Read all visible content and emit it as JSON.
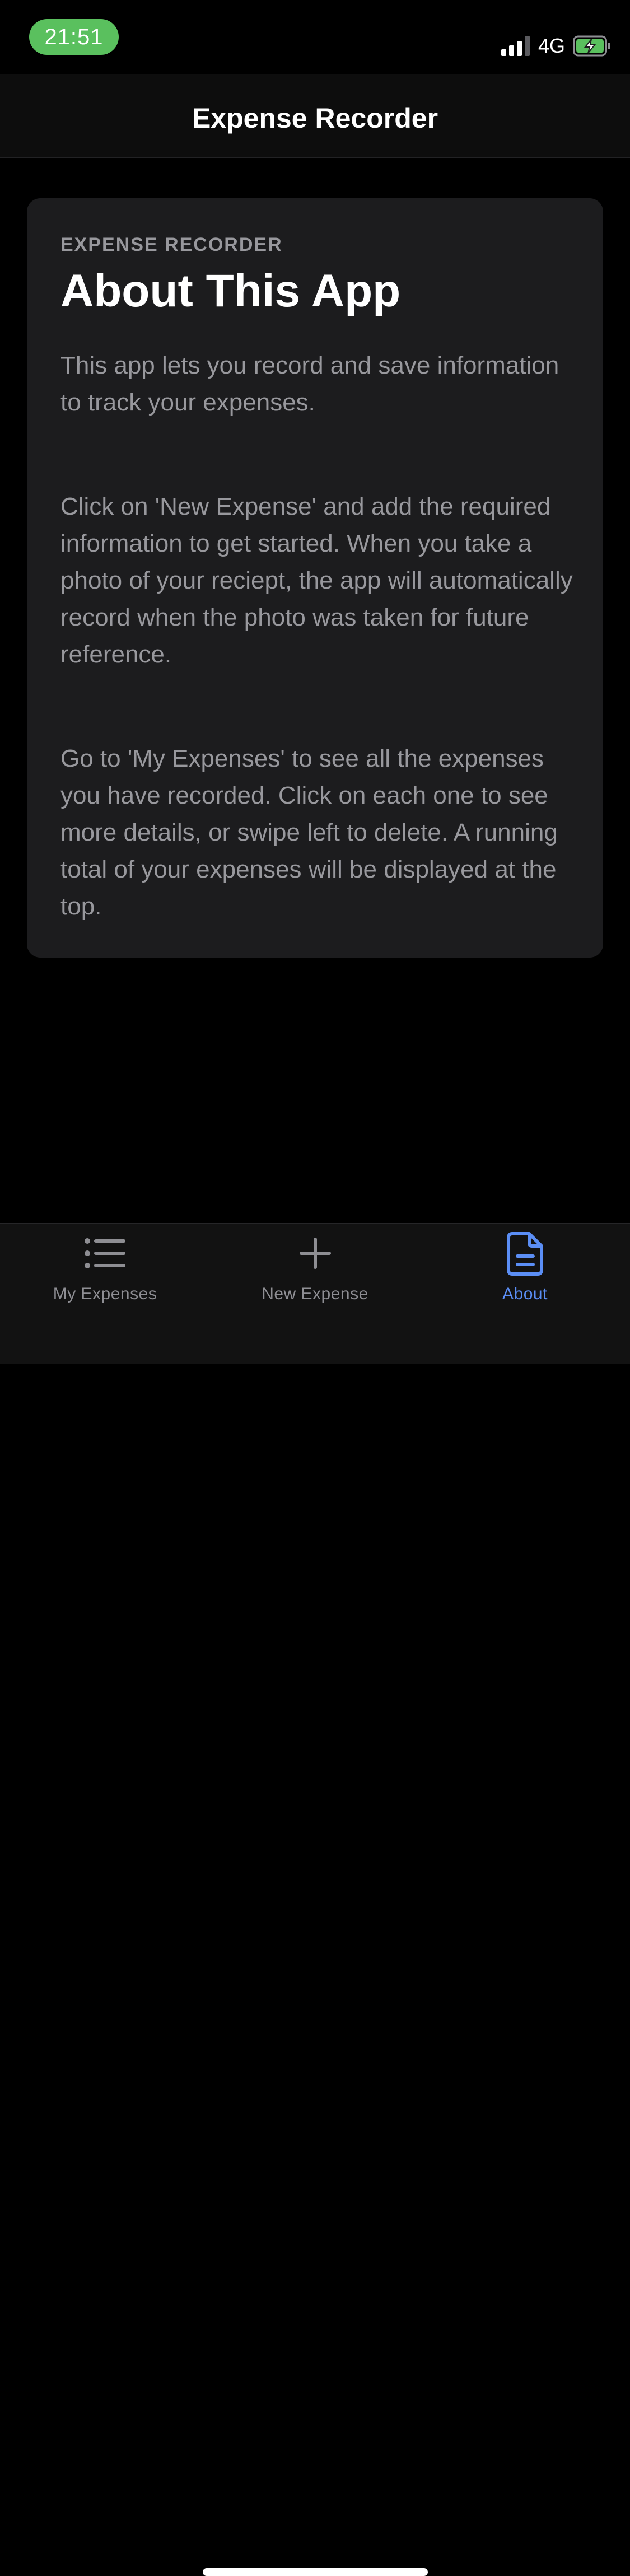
{
  "status_bar": {
    "time": "21:51",
    "network": "4G",
    "time_pill_color": "#5ac05e"
  },
  "nav": {
    "title": "Expense Recorder"
  },
  "card": {
    "eyebrow": "EXPENSE RECORDER",
    "title": "About This App",
    "paragraphs": [
      "This app lets you record and save information to track your expenses.",
      "Click on 'New Expense' and add the required information to get started. When you take a photo of your reciept, the app will automatically record when the photo was taken for future reference.",
      "Go to 'My Expenses' to see all the expenses you have recorded. Click on each one to see more details, or swipe left to delete. A running total of your expenses will be displayed at the top."
    ]
  },
  "tab_bar": {
    "active_color": "#5b8ef5",
    "tabs": [
      {
        "label": "My Expenses",
        "icon": "list-icon",
        "active": false
      },
      {
        "label": "New Expense",
        "icon": "plus-icon",
        "active": false
      },
      {
        "label": "About",
        "icon": "document-icon",
        "active": true
      }
    ]
  }
}
